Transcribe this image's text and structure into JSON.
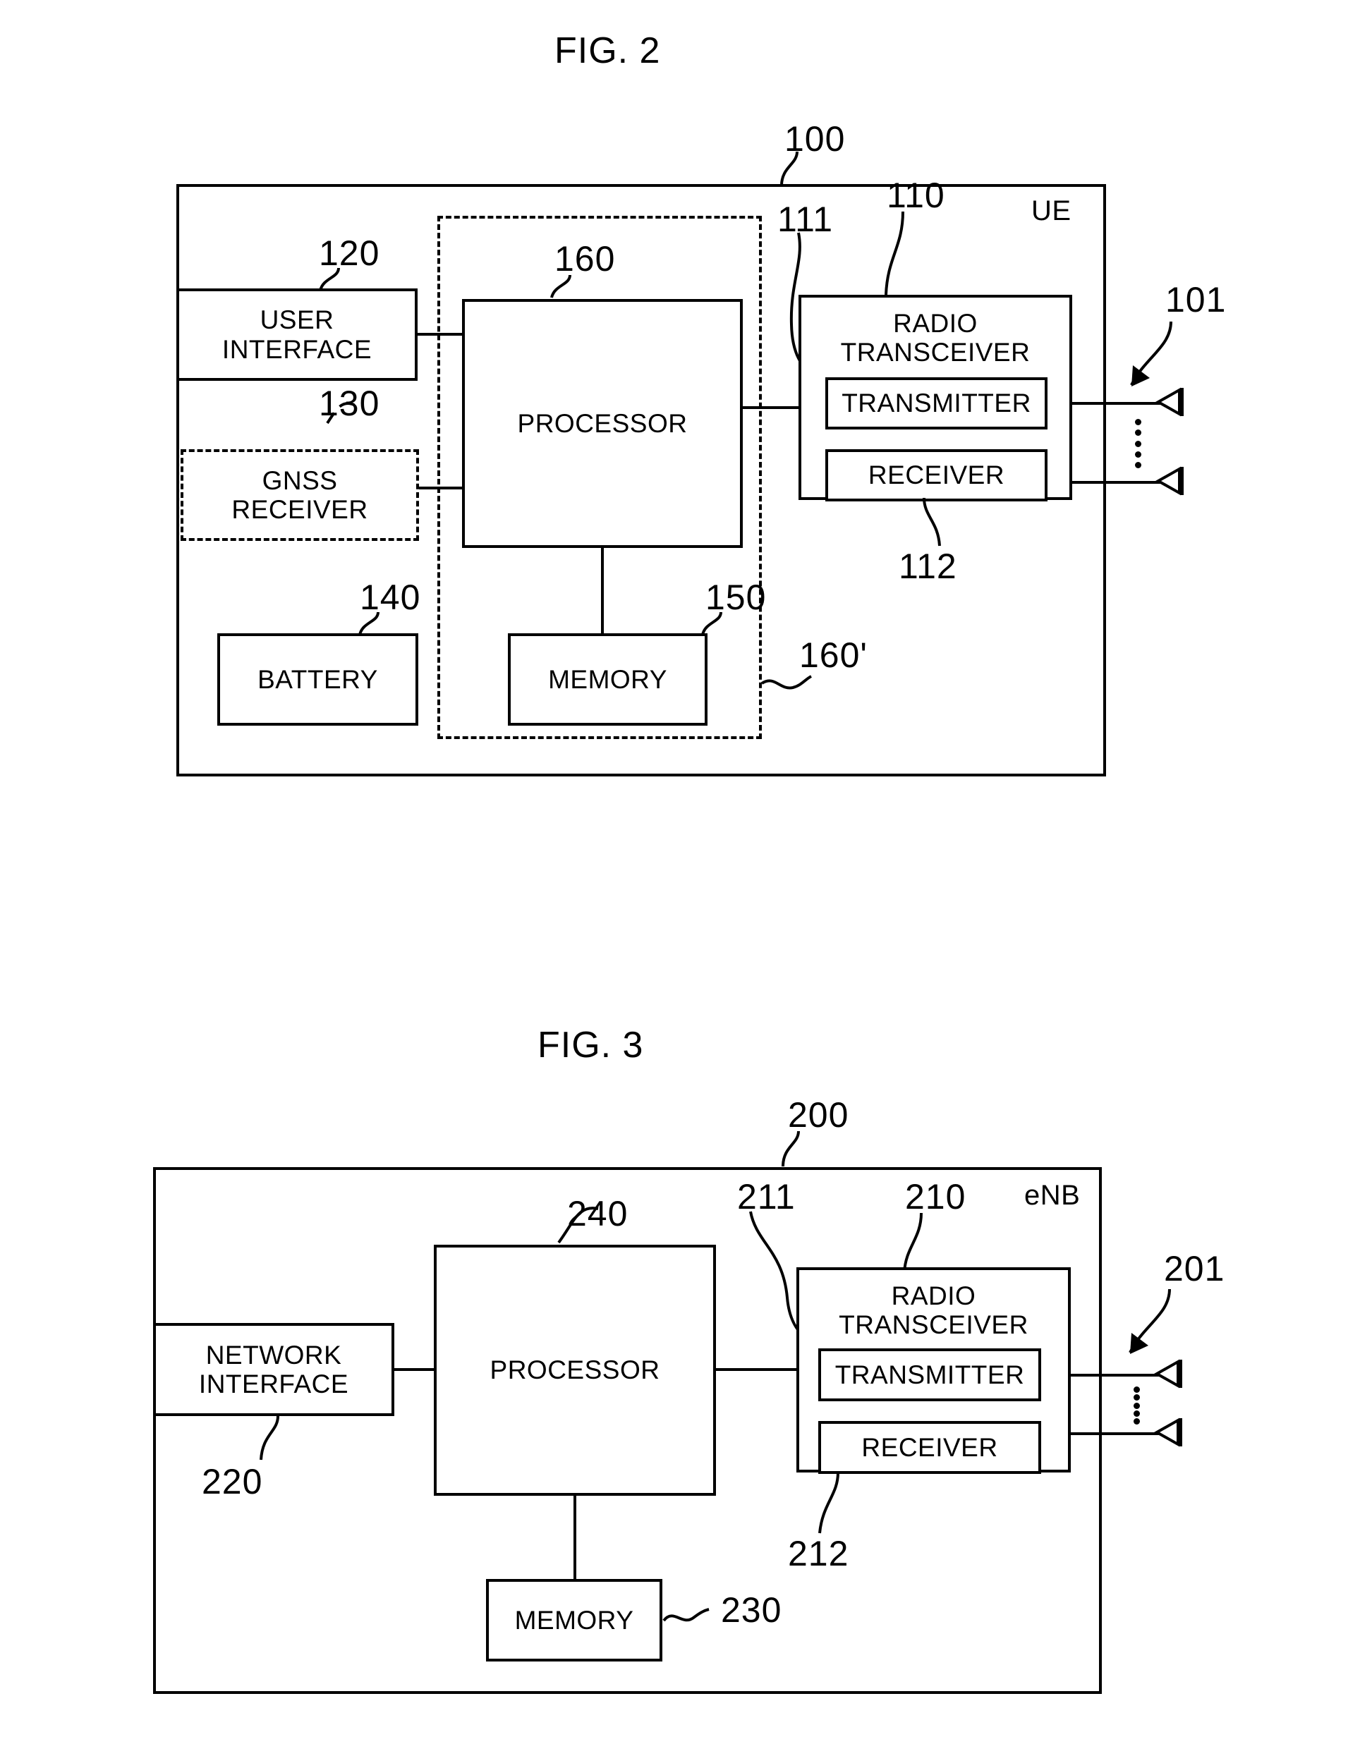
{
  "figures": [
    {
      "id": "fig2",
      "title": "FIG. 2",
      "device_tag": "UE",
      "device_ref": "100",
      "blocks": [
        {
          "key": "user_interface",
          "label": "USER\nINTERFACE",
          "ref": "120",
          "style": "solid"
        },
        {
          "key": "gnss_receiver",
          "label": "GNSS\nRECEIVER",
          "ref": "130",
          "style": "dashed"
        },
        {
          "key": "battery",
          "label": "BATTERY",
          "ref": "140",
          "style": "solid"
        },
        {
          "key": "memory",
          "label": "MEMORY",
          "ref": "150",
          "style": "solid"
        },
        {
          "key": "processor",
          "label": "PROCESSOR",
          "ref": "160",
          "style": "solid"
        },
        {
          "key": "processing_region",
          "label": "",
          "ref": "160'",
          "style": "dashed-region"
        },
        {
          "key": "radio_transceiver",
          "label": "RADIO\nTRANSCEIVER",
          "ref": "110",
          "style": "solid"
        },
        {
          "key": "transmitter",
          "label": "TRANSMITTER",
          "ref": "111",
          "style": "solid"
        },
        {
          "key": "receiver",
          "label": "RECEIVER",
          "ref": "112",
          "style": "solid"
        }
      ],
      "antenna_ref": "101",
      "antenna_count": 2
    },
    {
      "id": "fig3",
      "title": "FIG. 3",
      "device_tag": "eNB",
      "device_ref": "200",
      "blocks": [
        {
          "key": "network_interface",
          "label": "NETWORK\nINTERFACE",
          "ref": "220",
          "style": "solid"
        },
        {
          "key": "processor",
          "label": "PROCESSOR",
          "ref": "240",
          "style": "solid"
        },
        {
          "key": "memory",
          "label": "MEMORY",
          "ref": "230",
          "style": "solid"
        },
        {
          "key": "radio_transceiver",
          "label": "RADIO\nTRANSCEIVER",
          "ref": "210",
          "style": "solid"
        },
        {
          "key": "transmitter",
          "label": "TRANSMITTER",
          "ref": "211",
          "style": "solid"
        },
        {
          "key": "receiver",
          "label": "RECEIVER",
          "ref": "212",
          "style": "solid"
        }
      ],
      "antenna_ref": "201",
      "antenna_count": 2
    }
  ],
  "fig2": {
    "title": "FIG. 2",
    "device_tag": "UE",
    "ref_100": "100",
    "ref_120": "120",
    "ref_130": "130",
    "ref_140": "140",
    "ref_150": "150",
    "ref_160": "160",
    "ref_160p": "160'",
    "ref_110": "110",
    "ref_111": "111",
    "ref_112": "112",
    "ref_101": "101",
    "label_user_interface_l1": "USER",
    "label_user_interface_l2": "INTERFACE",
    "label_gnss_l1": "GNSS",
    "label_gnss_l2": "RECEIVER",
    "label_battery": "BATTERY",
    "label_memory": "MEMORY",
    "label_processor": "PROCESSOR",
    "label_radio_l1": "RADIO",
    "label_radio_l2": "TRANSCEIVER",
    "label_transmitter": "TRANSMITTER",
    "label_receiver": "RECEIVER"
  },
  "fig3": {
    "title": "FIG. 3",
    "device_tag": "eNB",
    "ref_200": "200",
    "ref_220": "220",
    "ref_230": "230",
    "ref_240": "240",
    "ref_210": "210",
    "ref_211": "211",
    "ref_212": "212",
    "ref_201": "201",
    "label_network_interface_l1": "NETWORK",
    "label_network_interface_l2": "INTERFACE",
    "label_processor": "PROCESSOR",
    "label_memory": "MEMORY",
    "label_radio_l1": "RADIO",
    "label_radio_l2": "TRANSCEIVER",
    "label_transmitter": "TRANSMITTER",
    "label_receiver": "RECEIVER"
  },
  "colors": {
    "stroke": "#000000",
    "background": "#ffffff"
  }
}
